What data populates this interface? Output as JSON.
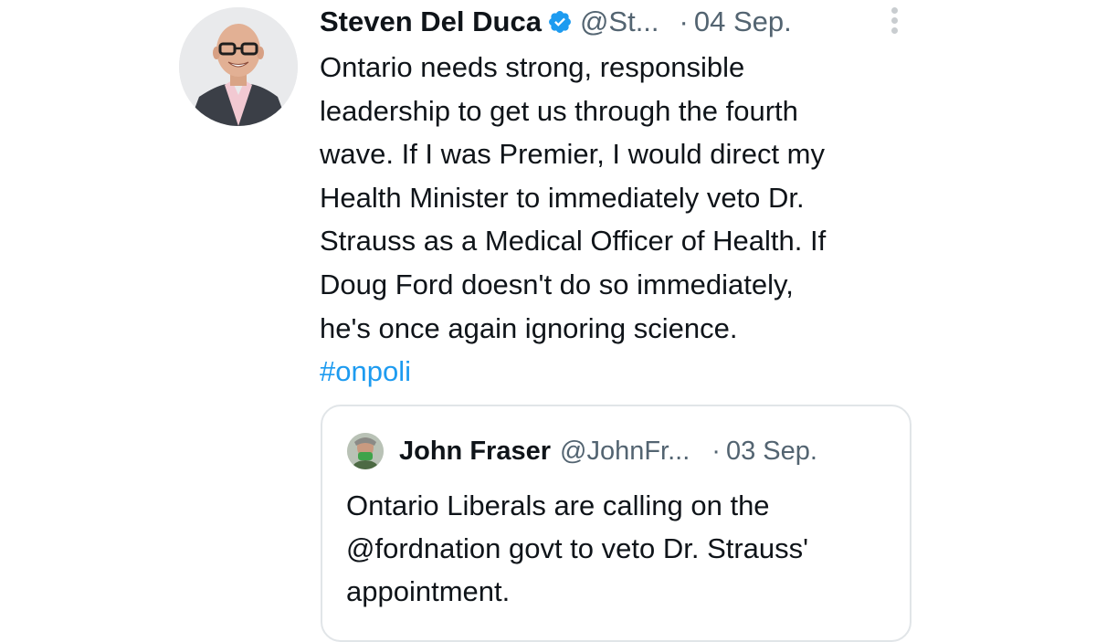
{
  "tweet": {
    "author_name": "Steven Del Duca",
    "handle": "@St...",
    "separator": "·",
    "date": "04 Sep.",
    "verified_icon": "verified-badge-icon",
    "more_icon": "more-options-icon",
    "text_lines": [
      "Ontario needs strong, responsible",
      "leadership to get us through the fourth",
      "wave. If I was Premier, I would direct my",
      "Health Minister to immediately veto Dr.",
      "Strauss as a Medical Officer of Health. If",
      "Doug Ford doesn't do so immediately,",
      "he's once again ignoring science."
    ],
    "hashtag": "#onpoli"
  },
  "quoted_tweet": {
    "author_name": "John Fraser",
    "handle": "@JohnFr...",
    "separator": "·",
    "date": "03 Sep.",
    "text_lines": [
      "Ontario Liberals are calling on the",
      "@fordnation govt to veto Dr. Strauss'",
      "appointment."
    ]
  },
  "colors": {
    "text": "#0f1419",
    "secondary_text": "#536471",
    "link": "#1d9bf0",
    "verified": "#1d9bf0",
    "quote_border": "#e1e5e8"
  }
}
